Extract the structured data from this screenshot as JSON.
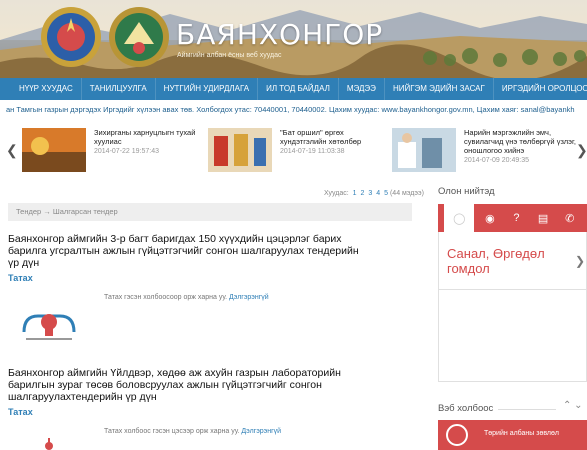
{
  "header": {
    "title": "БАЯНХОНГОР",
    "subtitle": "Аймгийн албан ёсны веб хуудас"
  },
  "nav": {
    "items": [
      {
        "label": "НҮҮР ХУУДАС"
      },
      {
        "label": "ТАНИЛЦУУЛГА"
      },
      {
        "label": "НУТГИЙН УДИРДЛАГА"
      },
      {
        "label": "ИЛ ТОД БАЙДАЛ"
      },
      {
        "label": "МЭДЭЭ"
      },
      {
        "label": "НИЙГЭМ ЭДИЙН ЗАСАГ"
      },
      {
        "label": "ИРГЭДИЙН ОРОЛЦОО"
      }
    ],
    "more_icon": "chevron-down-icon"
  },
  "ticker": {
    "text": "ан Тамгын газрын дэргэдэх Иргэдийг хүлээн авах төв. Холбогдох утас: 70440001, 70440002. Цахим хуудас: www.bayankhongor.gov.mn, Цахим хаяг: sanal@bayankh"
  },
  "news_strip": {
    "items": [
      {
        "title": "Зихирганы харнуцлыгн тухай хуулиас",
        "date": "2014-07-22 19:57:43"
      },
      {
        "title": "\"Бат оршил\" өргөх хундэтгэлийн хөтөлбөр",
        "date": "2014-07-19 11:03:38"
      },
      {
        "title": "Нарийн мэргэжлийн эмч, сувилагчид үнэ төлбөргүй үзлэг, оношлогоо хийнэ",
        "date": "2014-07-09 20:49:35"
      }
    ]
  },
  "pager": {
    "label": "Хуудас:",
    "pages": [
      "1",
      "2",
      "3",
      "4",
      "5"
    ],
    "count": "(44 мэдээ)"
  },
  "breadcrumb": {
    "text": "Тендер  →  Шалгарсан тендер"
  },
  "articles": [
    {
      "title": "Баянхонгор аймгийн 3-р багт баригдах 150 хүүхдийн цэцэрлэг барих барилга угсралтын ажлын гүйцэтгэгчийг сонгон шалгаруулах тендерийн үр дүн",
      "attachment_label": "Татах",
      "attachment_note": "Татах гэсэн холбоосоор орж харна уу.",
      "attachment_link": "Дэлгэрэнгүй"
    },
    {
      "title": "Баянхонгор аймгийн Үйлдвэр, хөдөө аж ахуйн газрын лабораторийн барилгын зураг төсөв боловсруулах ажлын гүйцэтгэгчийг сонгон шалгаруулахтендерийн үр дүн",
      "attachment_label": "Татах",
      "attachment_note": "Татах холбоос гэсэн цэсээр орж харна уу.",
      "attachment_link": "Дэлгэрэнгүй"
    }
  ],
  "sidebar": {
    "popular_title": "Олон нийтэд",
    "tabs": [
      "speech-bubble-icon",
      "camera-icon",
      "question-icon",
      "chat-icon",
      "phone-icon"
    ],
    "feedback_label": "Санал, Өргөдөл гомдол",
    "weblinks_title": "Вэб холбоос",
    "weblinks_button": "Төрийн албаны зөвлөл"
  },
  "colors": {
    "nav_blue": "#2f7fb6",
    "accent_red": "#d54b4b"
  }
}
